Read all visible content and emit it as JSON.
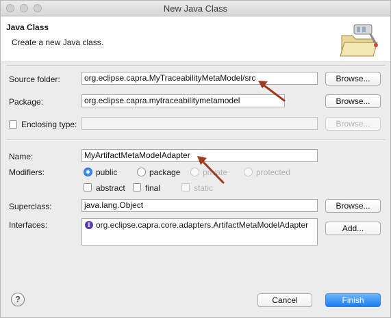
{
  "window": {
    "title": "New Java Class"
  },
  "banner": {
    "title": "Java Class",
    "description": "Create a new Java class."
  },
  "source_folder": {
    "label": "Source folder:",
    "value": "org.eclipse.capra.MyTraceabilityMetaModel/src",
    "browse": "Browse..."
  },
  "package": {
    "label": "Package:",
    "value": "org.eclipse.capra.mytraceabilitymetamodel",
    "browse": "Browse..."
  },
  "enclosing_type": {
    "label": "Enclosing type:",
    "value": "",
    "browse": "Browse..."
  },
  "name": {
    "label": "Name:",
    "value": "MyArtifactMetaModelAdapter"
  },
  "modifiers": {
    "label": "Modifiers:",
    "access": [
      "public",
      "package",
      "private",
      "protected"
    ],
    "selected": "public",
    "flags": [
      "abstract",
      "final",
      "static"
    ]
  },
  "superclass": {
    "label": "Superclass:",
    "value": "java.lang.Object",
    "browse": "Browse..."
  },
  "interfaces": {
    "label": "Interfaces:",
    "items": [
      "org.eclipse.capra.core.adapters.ArtifactMetaModelAdapter"
    ],
    "add": "Add..."
  },
  "footer": {
    "help": "?",
    "cancel": "Cancel",
    "finish": "Finish"
  },
  "colors": {
    "annotation_arrow": "#a0391d",
    "accent": "#1a7ff2"
  }
}
